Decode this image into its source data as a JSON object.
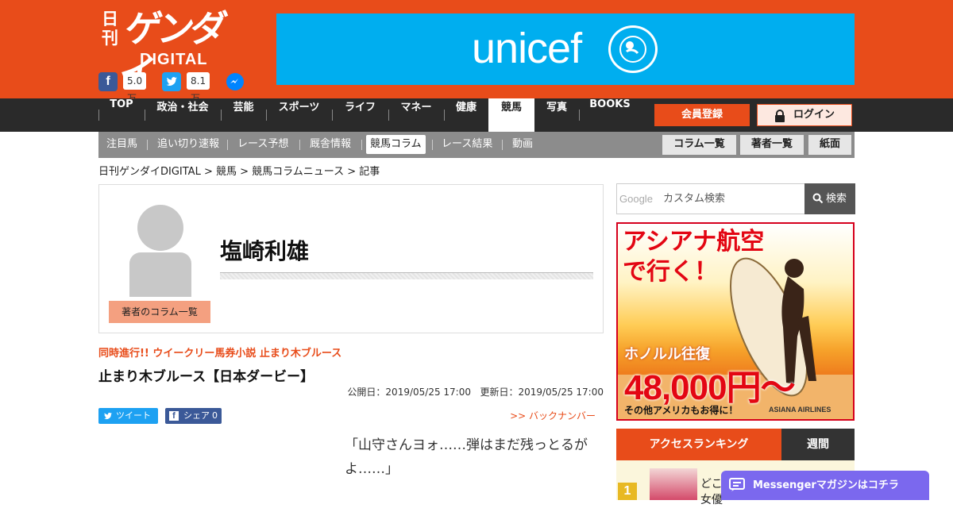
{
  "header": {
    "logo": {
      "nikkan": "日刊",
      "gendai": "ゲンダイ",
      "digital": "DIGITAL"
    },
    "social": {
      "facebook_count": "5.0万",
      "twitter_count": "8.1万"
    },
    "banner_text": "unicef"
  },
  "nav": {
    "items": [
      {
        "label": "TOP"
      },
      {
        "label": "政治・社会"
      },
      {
        "label": "芸能"
      },
      {
        "label": "スポーツ"
      },
      {
        "label": "ライフ"
      },
      {
        "label": "マネー"
      },
      {
        "label": "健康"
      },
      {
        "label": "競馬"
      },
      {
        "label": "写真"
      },
      {
        "label": "BOOKS"
      }
    ],
    "active": "競馬",
    "register": "会員登録",
    "login": "ログイン"
  },
  "subnav": {
    "items": [
      {
        "label": "注目馬"
      },
      {
        "label": "追い切り速報"
      },
      {
        "label": "レース予想"
      },
      {
        "label": "厩舎情報"
      },
      {
        "label": "競馬コラム"
      },
      {
        "label": "レース結果"
      },
      {
        "label": "動画"
      }
    ],
    "active": "競馬コラム",
    "buttons": [
      {
        "label": "コラム一覧"
      },
      {
        "label": "著者一覧"
      },
      {
        "label": "紙面"
      }
    ]
  },
  "breadcrumb": "日刊ゲンダイDIGITAL > 競馬 > 競馬コラムニュース > 記事",
  "author": {
    "name": "塩崎利雄",
    "columns_button": "著者のコラム一覧"
  },
  "article": {
    "series": "同時進行!! ウイークリー馬券小説 止まり木ブルース",
    "title": "止まり木ブルース【日本ダービー】",
    "published": "公開日：2019/05/25 17:00",
    "updated": "更新日：2019/05/25 17:00",
    "tweet": "ツイート",
    "share": "シェア",
    "share_count": "0",
    "back_number": ">> バックナンバー",
    "body": "「山守さんヨォ……弾はまだ残っとるがよ……」"
  },
  "sidebar": {
    "search": {
      "brand": "Google",
      "placeholder": "カスタム検索",
      "button": "検索"
    },
    "ad": {
      "headline": "アシアナ航空\nで行く！",
      "route": "ホノルル往復",
      "price": "48,000円〜",
      "footer": "その他アメリカもお得に！",
      "brand": "ASIANA AIRLINES"
    },
    "ranking": {
      "title": "アクセスランキング",
      "tab": "週間",
      "first_rank": "1",
      "first_text": "どこ\n女優"
    }
  },
  "messenger": {
    "label": "Messengerマガジンはコチラ"
  },
  "colors": {
    "brand": "#e84c1a",
    "nav": "#2a2a2a",
    "subnav": "#8c8c8c",
    "unicef": "#00aeef",
    "messenger": "#7b68ee"
  }
}
